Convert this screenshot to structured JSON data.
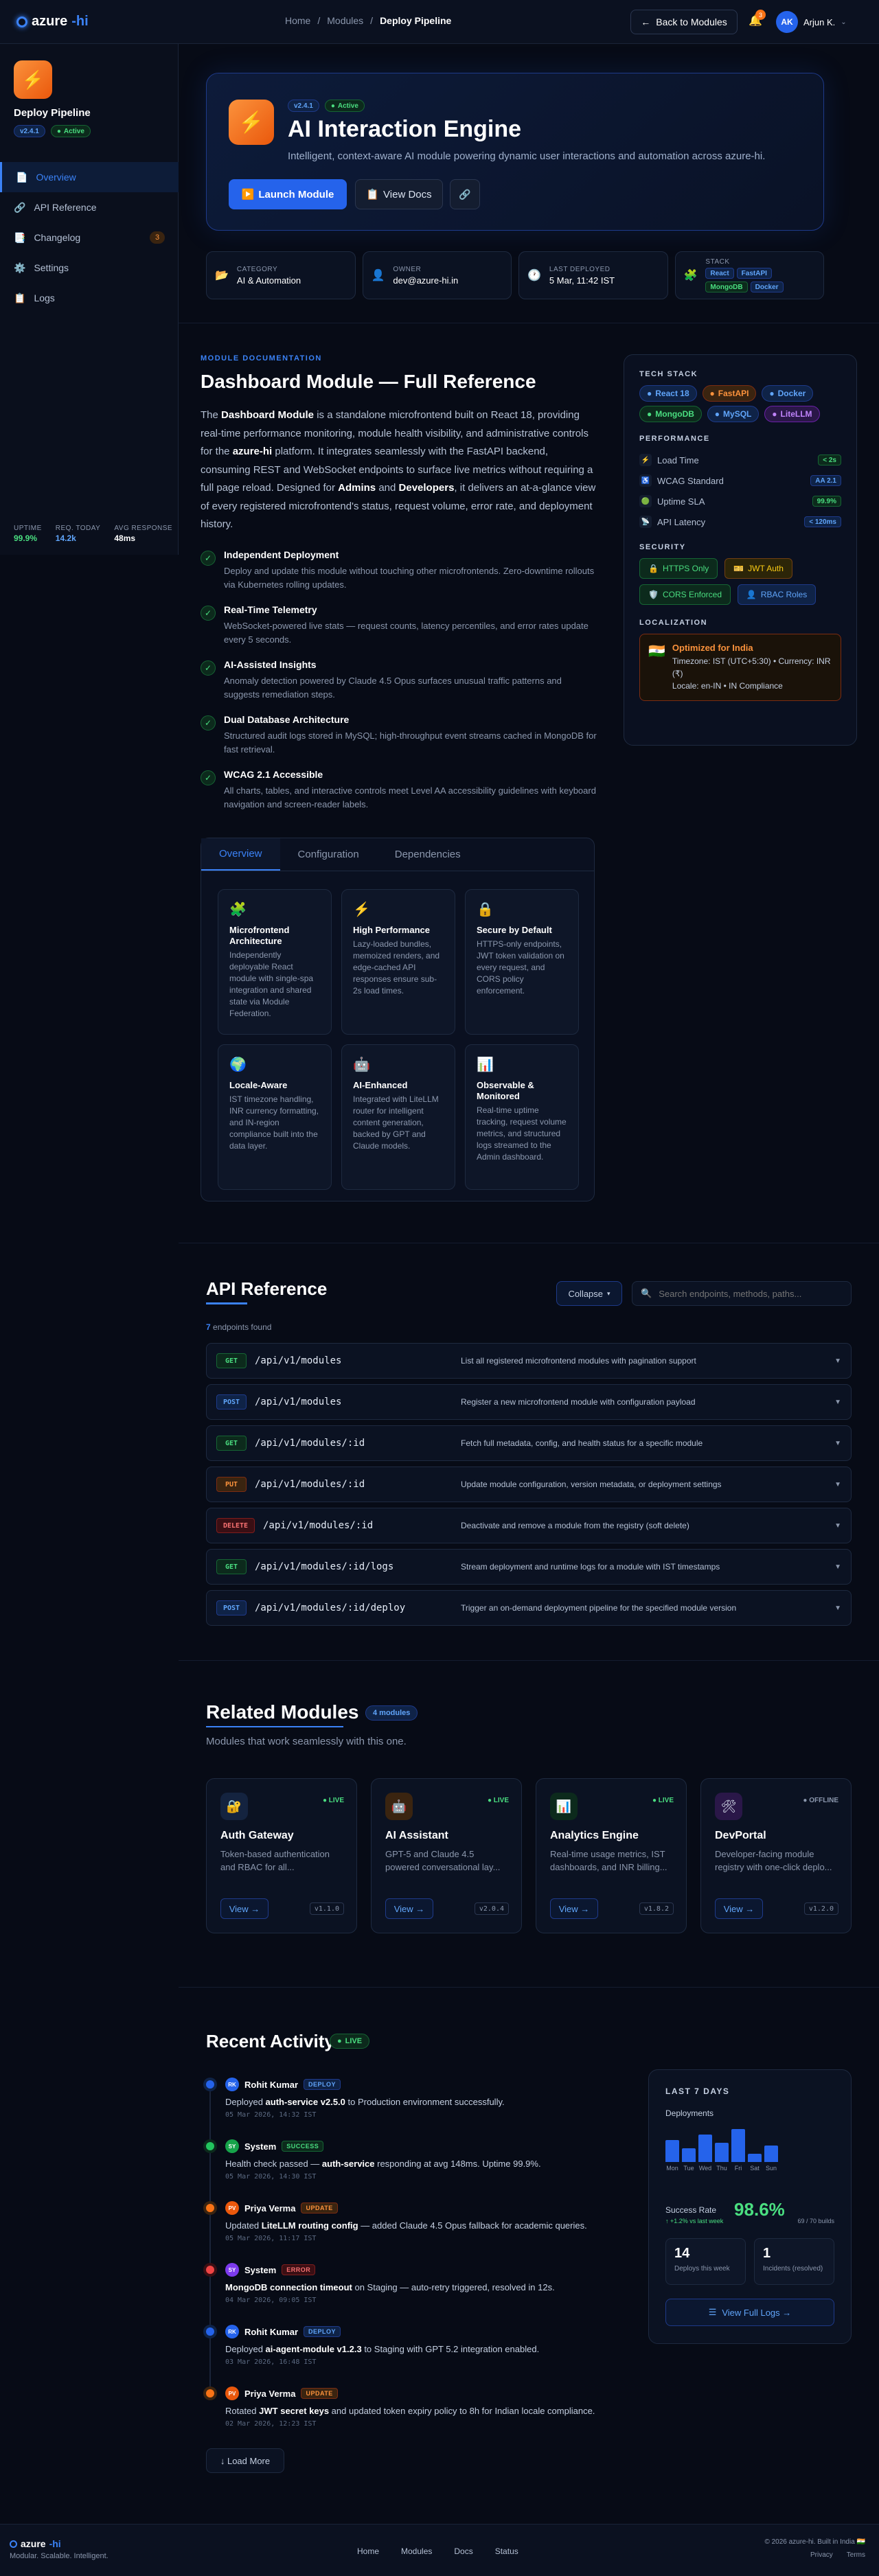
{
  "header": {
    "logo_main": "azure",
    "logo_accent": "-hi",
    "breadcrumb": [
      "Home",
      "Modules",
      "Deploy Pipeline"
    ],
    "back_label": "Back to Modules",
    "notification_count": "3",
    "user_initials": "AK",
    "user_name": "Arjun K."
  },
  "sidebar": {
    "title": "Deploy Pipeline",
    "version": "v2.4.1",
    "status": "Active",
    "items": [
      {
        "label": "Overview",
        "icon": "file-icon"
      },
      {
        "label": "API Reference",
        "icon": "link-icon"
      },
      {
        "label": "Changelog",
        "icon": "list-icon",
        "count": "3"
      },
      {
        "label": "Settings",
        "icon": "gear-icon"
      },
      {
        "label": "Logs",
        "icon": "clipboard-icon"
      }
    ],
    "stats": [
      {
        "label": "UPTIME",
        "value": "99.9%",
        "color": "#4ade80"
      },
      {
        "label": "REQ. TODAY",
        "value": "14.2k",
        "color": "#60a5fa"
      },
      {
        "label": "AVG RESPONSE",
        "value": "48ms",
        "color": "#ffffff"
      }
    ]
  },
  "hero": {
    "version": "v2.4.1",
    "status": "Active",
    "title": "AI Interaction Engine",
    "description": "Intelligent, context-aware AI module powering dynamic user interactions and automation across azure-hi.",
    "launch_label": "Launch Module",
    "docs_label": "View Docs"
  },
  "info": {
    "category_label": "CATEGORY",
    "category": "AI & Automation",
    "owner_label": "OWNER",
    "owner": "dev@azure-hi.in",
    "deployed_label": "LAST DEPLOYED",
    "deployed": "5 Mar, 11:42 IST",
    "stack_label": "STACK",
    "stack": [
      "React",
      "FastAPI",
      "MongoDB",
      "Docker"
    ]
  },
  "docs": {
    "kicker": "MODULE DOCUMENTATION",
    "title": "Dashboard Module — Full Reference",
    "body": {
      "p1": "The ",
      "b1": "Dashboard Module",
      "p2": " is a standalone microfrontend built on React 18, providing real-time performance monitoring, module health visibility, and administrative controls for the ",
      "b2": "azure-hi",
      "p3": " platform. It integrates seamlessly with the FastAPI backend, consuming REST and WebSocket endpoints to surface live metrics without requiring a full page reload. Designed for ",
      "b3": "Admins",
      "p4": " and ",
      "b4": "Developers",
      "p5": ", it delivers an at-a-glance view of every registered microfrontend's status, request volume, error rate, and deployment history."
    },
    "features": [
      {
        "title": "Independent Deployment",
        "desc": "Deploy and update this module without touching other microfrontends. Zero-downtime rollouts via Kubernetes rolling updates."
      },
      {
        "title": "Real-Time Telemetry",
        "desc": "WebSocket-powered live stats — request counts, latency percentiles, and error rates update every 5 seconds."
      },
      {
        "title": "AI-Assisted Insights",
        "desc": "Anomaly detection powered by Claude 4.5 Opus surfaces unusual traffic patterns and suggests remediation steps."
      },
      {
        "title": "Dual Database Architecture",
        "desc": "Structured audit logs stored in MySQL; high-throughput event streams cached in MongoDB for fast retrieval."
      },
      {
        "title": "WCAG 2.1 Accessible",
        "desc": "All charts, tables, and interactive controls meet Level AA accessibility guidelines with keyboard navigation and screen-reader labels."
      }
    ],
    "tabs": [
      "Overview",
      "Configuration",
      "Dependencies"
    ],
    "cards": [
      {
        "icon": "puzzle-icon",
        "glyph": "🧩",
        "title": "Microfrontend Architecture",
        "desc": "Independently deployable React module with single-spa integration and shared state via Module Federation."
      },
      {
        "icon": "bolt-icon",
        "glyph": "⚡",
        "title": "High Performance",
        "desc": "Lazy-loaded bundles, memoized renders, and edge-cached API responses ensure sub-2s load times."
      },
      {
        "icon": "lock-icon",
        "glyph": "🔒",
        "title": "Secure by Default",
        "desc": "HTTPS-only endpoints, JWT token validation on every request, and CORS policy enforcement."
      },
      {
        "icon": "globe-icon",
        "glyph": "🌍",
        "title": "Locale-Aware",
        "desc": "IST timezone handling, INR currency formatting, and IN-region compliance built into the data layer."
      },
      {
        "icon": "robot-icon",
        "glyph": "🤖",
        "title": "AI-Enhanced",
        "desc": "Integrated with LiteLLM router for intelligent content generation, backed by GPT and Claude models."
      },
      {
        "icon": "chart-icon",
        "glyph": "📊",
        "title": "Observable & Monitored",
        "desc": "Real-time uptime tracking, request volume metrics, and structured logs streamed to the Admin dashboard."
      }
    ]
  },
  "techcard": {
    "stack_heading": "TECH STACK",
    "stack": [
      {
        "label": "React 18",
        "color": "blue"
      },
      {
        "label": "FastAPI",
        "color": "orange"
      },
      {
        "label": "Docker",
        "color": "blue"
      },
      {
        "label": "MongoDB",
        "color": "green"
      },
      {
        "label": "MySQL",
        "color": "blue"
      },
      {
        "label": "LiteLLM",
        "color": "purple"
      }
    ],
    "perf_heading": "PERFORMANCE",
    "perf": [
      {
        "label": "Load Time",
        "value": "< 2s",
        "color": "green"
      },
      {
        "label": "WCAG Standard",
        "value": "AA 2.1",
        "color": "blue"
      },
      {
        "label": "Uptime SLA",
        "value": "99.9%",
        "color": "green"
      },
      {
        "label": "API Latency",
        "value": "< 120ms",
        "color": "blue"
      }
    ],
    "security_heading": "SECURITY",
    "security": [
      {
        "label": "HTTPS Only",
        "color": "g"
      },
      {
        "label": "JWT Auth",
        "color": "y"
      },
      {
        "label": "CORS Enforced",
        "color": "g"
      },
      {
        "label": "RBAC Roles",
        "color": "b"
      }
    ],
    "loc_heading": "LOCALIZATION",
    "loc_title": "Optimized for India",
    "loc_line1": "Timezone: IST (UTC+5:30) • Currency: INR (₹)",
    "loc_line2": "Locale: en-IN • IN Compliance"
  },
  "api": {
    "title": "API Reference",
    "collapse_label": "Collapse",
    "search_placeholder": "Search endpoints, methods, paths...",
    "count": "7",
    "count_suffix": " endpoints found",
    "endpoints": [
      {
        "method": "GET",
        "path": "/api/v1/modules",
        "desc": "List all registered microfrontend modules with pagination support"
      },
      {
        "method": "POST",
        "path": "/api/v1/modules",
        "desc": "Register a new microfrontend module with configuration payload"
      },
      {
        "method": "GET",
        "path": "/api/v1/modules/:id",
        "desc": "Fetch full metadata, config, and health status for a specific module"
      },
      {
        "method": "PUT",
        "path": "/api/v1/modules/:id",
        "desc": "Update module configuration, version metadata, or deployment settings"
      },
      {
        "method": "DELETE",
        "path": "/api/v1/modules/:id",
        "desc": "Deactivate and remove a module from the registry (soft delete)"
      },
      {
        "method": "GET",
        "path": "/api/v1/modules/:id/logs",
        "desc": "Stream deployment and runtime logs for a module with IST timestamps"
      },
      {
        "method": "POST",
        "path": "/api/v1/modules/:id/deploy",
        "desc": "Trigger an on-demand deployment pipeline for the specified module version"
      }
    ]
  },
  "related": {
    "title": "Related Modules",
    "badge": "4 modules",
    "subtitle": "Modules that work seamlessly with this one.",
    "view_label": "View →",
    "modules": [
      {
        "name": "Auth Gateway",
        "desc": "Token-based authentication and RBAC for all...",
        "status": "LIVE",
        "version": "v1.1.0",
        "glyph": "🔐",
        "bg": "#14233f"
      },
      {
        "name": "AI Assistant",
        "desc": "GPT-5 and Claude 4.5 powered conversational lay...",
        "status": "LIVE",
        "version": "v2.0.4",
        "glyph": "🤖",
        "bg": "#3a2410"
      },
      {
        "name": "Analytics Engine",
        "desc": "Real-time usage metrics, IST dashboards, and INR billing...",
        "status": "LIVE",
        "version": "v1.8.2",
        "glyph": "📊",
        "bg": "#0c2a1c"
      },
      {
        "name": "DevPortal",
        "desc": "Developer-facing module registry with one-click deplo...",
        "status": "OFFLINE",
        "version": "v1.2.0",
        "glyph": "🛠",
        "bg": "#2a1748"
      }
    ]
  },
  "activity": {
    "title": "Recent Activity",
    "live": "LIVE",
    "items": [
      {
        "initials": "RK",
        "name": "Rohit Kumar",
        "type": "DEPLOY",
        "pre": "Deployed ",
        "bold": "auth-service v2.5.0",
        "post": " to Production environment successfully.",
        "time": "05 Mar 2026, 14:32 IST",
        "dot": "#2563eb",
        "av": "#2563eb"
      },
      {
        "initials": "SY",
        "name": "System",
        "type": "SUCCESS",
        "pre": "Health check passed — ",
        "bold": "auth-service",
        "post": " responding at avg 148ms. Uptime 99.9%.",
        "time": "05 Mar 2026, 14:30 IST",
        "dot": "#22c55e",
        "av": "#16a34a"
      },
      {
        "initials": "PV",
        "name": "Priya Verma",
        "type": "UPDATE",
        "pre": "Updated ",
        "bold": "LiteLLM routing config",
        "post": " — added Claude 4.5 Opus fallback for academic queries.",
        "time": "05 Mar 2026, 11:17 IST",
        "dot": "#f97316",
        "av": "#ea580c"
      },
      {
        "initials": "SY",
        "name": "System",
        "type": "ERROR",
        "pre": "",
        "bold": "MongoDB connection timeout",
        "post": " on Staging — auto-retry triggered, resolved in 12s.",
        "time": "04 Mar 2026, 09:05 IST",
        "dot": "#ef4444",
        "av": "#7c3aed"
      },
      {
        "initials": "RK",
        "name": "Rohit Kumar",
        "type": "DEPLOY",
        "pre": "Deployed ",
        "bold": "ai-agent-module v1.2.3",
        "post": " to Staging with GPT 5.2 integration enabled.",
        "time": "03 Mar 2026, 16:48 IST",
        "dot": "#2563eb",
        "av": "#2563eb"
      },
      {
        "initials": "PV",
        "name": "Priya Verma",
        "type": "UPDATE",
        "pre": "Rotated ",
        "bold": "JWT secret keys",
        "post": " and updated token expiry policy to 8h for Indian locale compliance.",
        "time": "02 Mar 2026, 12:23 IST",
        "dot": "#f97316",
        "av": "#ea580c"
      }
    ],
    "load_more": "↓ Load More"
  },
  "stats": {
    "heading": "LAST 7 DAYS",
    "deploy_label": "Deployments",
    "chart_data": {
      "type": "bar",
      "categories": [
        "Mon",
        "Tue",
        "Wed",
        "Thu",
        "Fri",
        "Sat",
        "Sun"
      ],
      "values": [
        4,
        2.5,
        5,
        3.5,
        6,
        1.5,
        3
      ],
      "ylim": [
        0,
        7
      ]
    },
    "success_label": "Success Rate",
    "success_value": "98.6%",
    "success_delta": "↑ +1.2% vs last week",
    "success_builds": "69 / 70 builds",
    "mini": [
      {
        "value": "14",
        "label": "Deploys this week"
      },
      {
        "value": "1",
        "label": "Incidents (resolved)"
      }
    ],
    "full_logs": "View Full Logs →"
  },
  "footer": {
    "tagline": "Modular. Scalable. Intelligent.",
    "nav": [
      "Home",
      "Modules",
      "Docs",
      "Status"
    ],
    "copyright": "© 2026 azure-hi. Built in India 🇮🇳",
    "links": [
      "Privacy",
      "Terms"
    ]
  }
}
